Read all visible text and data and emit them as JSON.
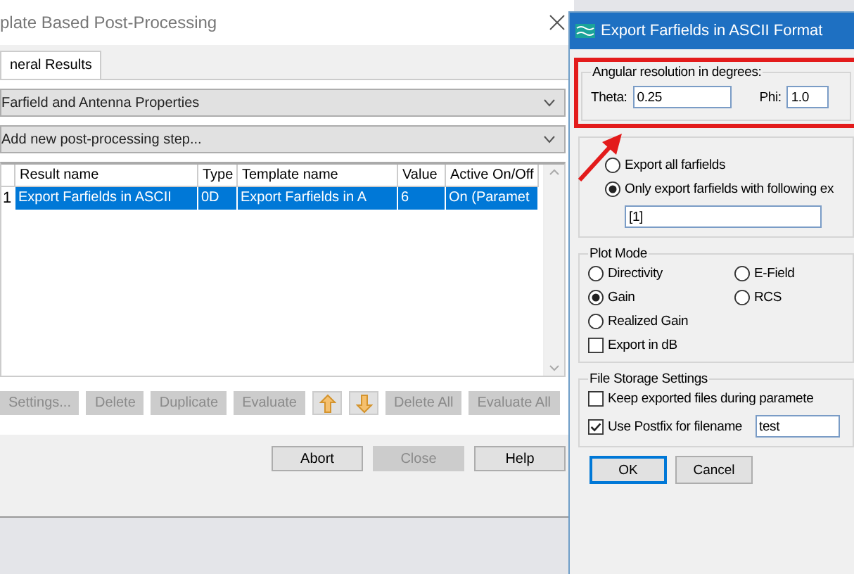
{
  "main_dialog": {
    "title": "plate Based Post-Processing",
    "tabs": [
      {
        "label": "neral Results",
        "selected": true
      }
    ],
    "dropdowns": [
      "Farfield and Antenna Properties",
      "Add new post-processing step..."
    ],
    "table": {
      "columns": [
        "Result name",
        "Type",
        "Template name",
        "Value",
        "Active On/Off"
      ],
      "rows": [
        {
          "number": "1",
          "cells": [
            "Export Farfields in ASCII",
            "0D",
            "Export Farfields in A",
            "6",
            "On (Paramet"
          ],
          "selected": true
        }
      ]
    },
    "actions": [
      {
        "kind": "text",
        "label": "Settings...",
        "disabled": true
      },
      {
        "kind": "text",
        "label": "Delete",
        "disabled": true
      },
      {
        "kind": "text",
        "label": "Duplicate",
        "disabled": true
      },
      {
        "kind": "text",
        "label": "Evaluate",
        "disabled": true
      },
      {
        "kind": "up",
        "disabled": false
      },
      {
        "kind": "down",
        "disabled": false
      },
      {
        "kind": "text",
        "label": "Delete All",
        "disabled": true
      },
      {
        "kind": "text",
        "label": "Evaluate All",
        "disabled": true
      }
    ],
    "buttons": [
      {
        "label": "Abort",
        "disabled": false
      },
      {
        "label": "Close",
        "disabled": true
      },
      {
        "label": "Help",
        "disabled": false
      }
    ]
  },
  "export_dialog": {
    "title": "Export Farfields in ASCII Format",
    "resolution": {
      "legend": "Angular resolution in degrees:",
      "fields": [
        {
          "label": "Theta:",
          "value": "0.25"
        },
        {
          "label": "Phi:",
          "value": "1.0"
        }
      ]
    },
    "export_options": [
      {
        "label": "Export all farfields",
        "selected": false
      },
      {
        "label": "Only export farfields with following ex",
        "selected": true
      }
    ],
    "filter_value": "[1]",
    "plot_mode": {
      "legend": "Plot Mode",
      "options": [
        {
          "label": "Directivity",
          "selected": false
        },
        {
          "label": "E-Field",
          "selected": false
        },
        {
          "label": "Gain",
          "selected": true
        },
        {
          "label": "RCS",
          "selected": false
        },
        {
          "label": "Realized Gain",
          "selected": false
        }
      ],
      "export_db": {
        "label": "Export in dB",
        "checked": false
      }
    },
    "file_storage": {
      "legend": "File Storage Settings",
      "checks": [
        {
          "label": "Keep exported files during paramete",
          "checked": false
        },
        {
          "label": "Use Postfix for filename",
          "checked": true
        }
      ],
      "postfix_value": "test"
    },
    "buttons": [
      "OK",
      "Cancel"
    ]
  }
}
